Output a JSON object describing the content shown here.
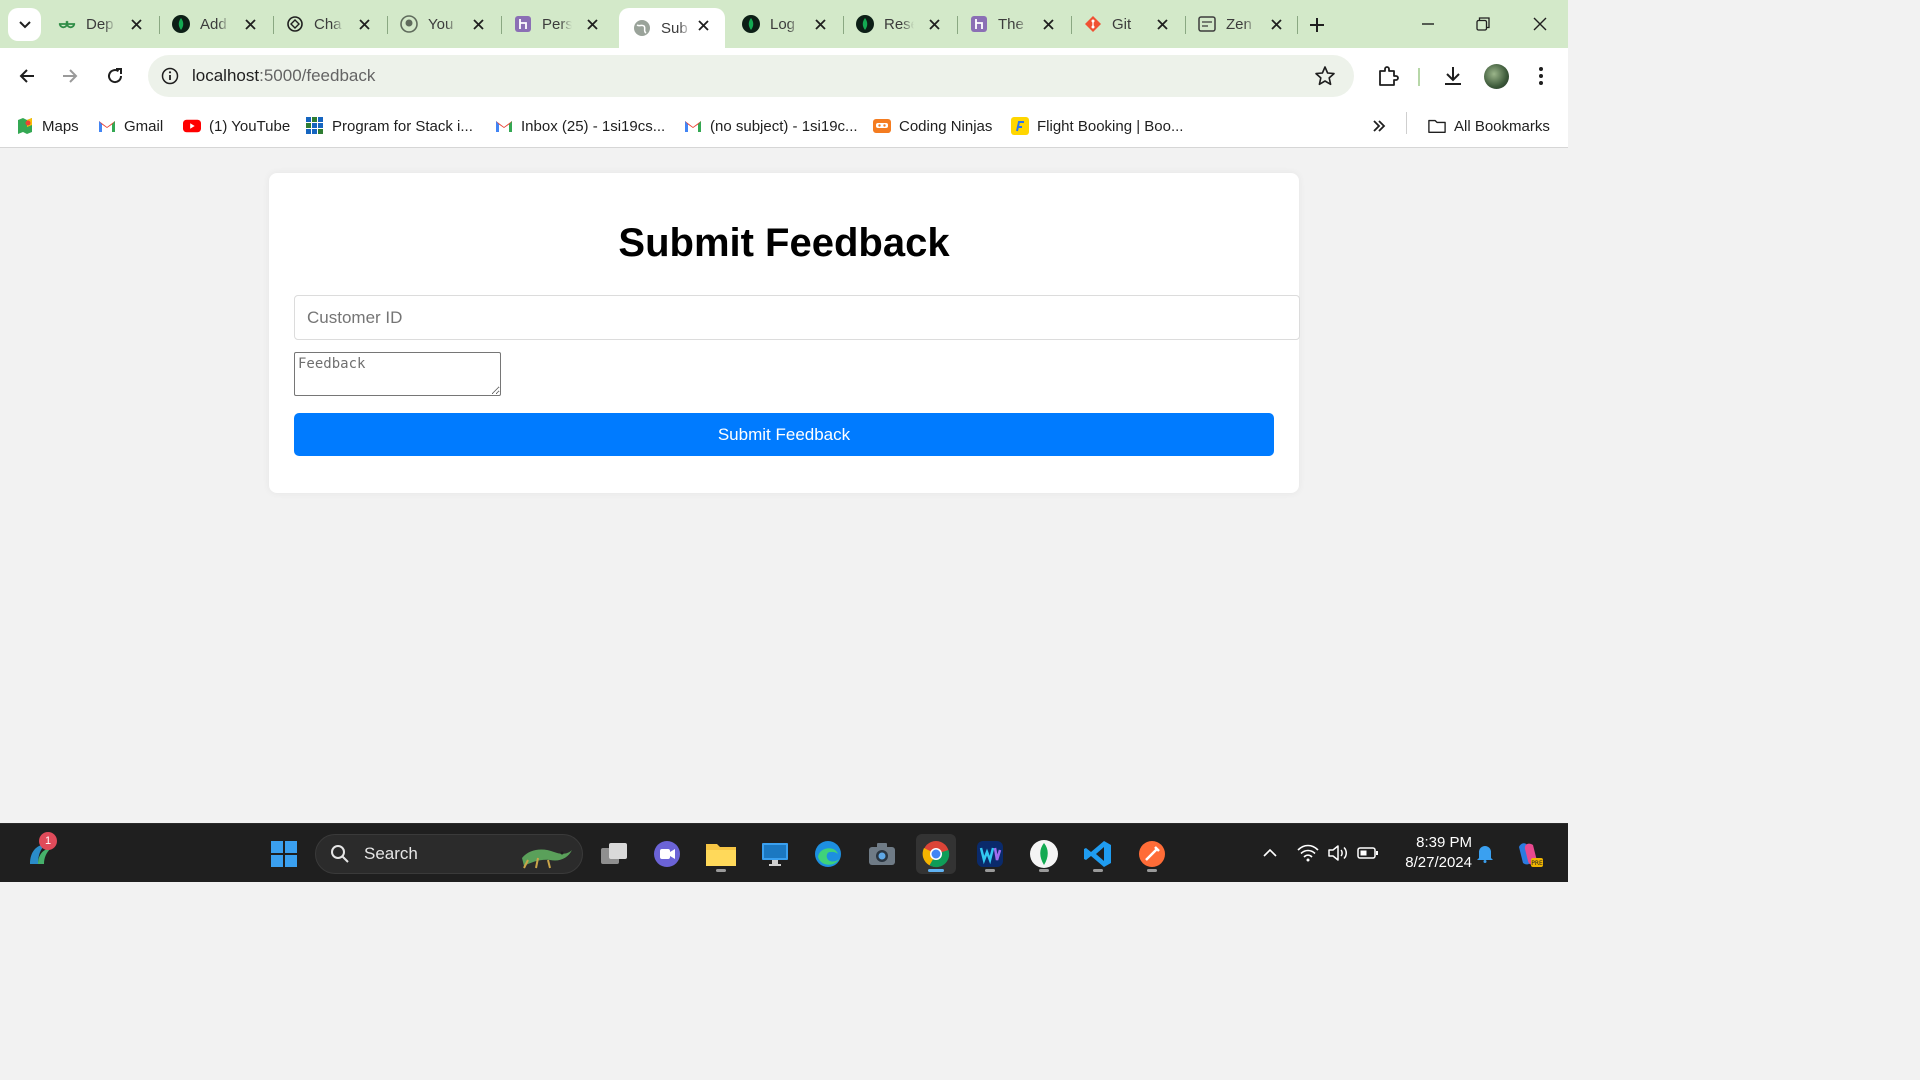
{
  "tabs": [
    {
      "title": "Dep",
      "icon": "geeksforgeeks-icon"
    },
    {
      "title": "Add",
      "icon": "mongodb-leaf-icon"
    },
    {
      "title": "Cha",
      "icon": "openai-icon"
    },
    {
      "title": "You",
      "icon": "github-icon"
    },
    {
      "title": "Pers",
      "icon": "heroku-icon"
    },
    {
      "title": "Sub",
      "icon": "globe-icon",
      "active": true
    },
    {
      "title": "Log",
      "icon": "mongodb-leaf-icon"
    },
    {
      "title": "Rese",
      "icon": "mongodb-leaf-icon"
    },
    {
      "title": "The",
      "icon": "heroku-icon"
    },
    {
      "title": "Git",
      "icon": "git-icon"
    },
    {
      "title": "Zen",
      "icon": "zen-class-icon"
    }
  ],
  "address": {
    "host": "localhost",
    "path": ":5000/feedback"
  },
  "bookmarks": {
    "maps": "Maps",
    "gmail": "Gmail",
    "youtube": "(1) YouTube",
    "program": "Program for Stack i...",
    "inbox": "Inbox (25) - 1si19cs...",
    "nosubject": "(no subject) - 1si19c...",
    "codingninjas": "Coding Ninjas",
    "flight": "Flight Booking | Boo...",
    "all": "All Bookmarks"
  },
  "page": {
    "heading": "Submit Feedback",
    "customer_id_placeholder": "Customer ID",
    "feedback_placeholder": "Feedback",
    "submit_label": "Submit Feedback"
  },
  "taskbar": {
    "search_label": "Search",
    "time": "8:39 PM",
    "date": "8/27/2024",
    "widget_badge": "1"
  },
  "colors": {
    "tabstrip": "#d3e9c9",
    "submit_button": "#007bff",
    "page_bg": "#f2f2f2"
  }
}
